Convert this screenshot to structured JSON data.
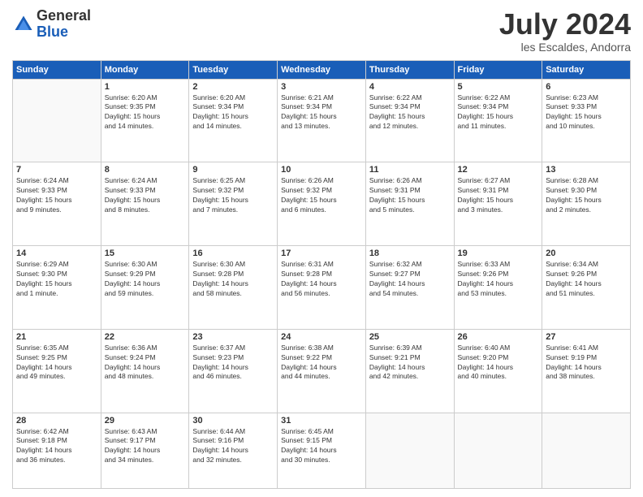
{
  "logo": {
    "general": "General",
    "blue": "Blue"
  },
  "header": {
    "month": "July 2024",
    "location": "les Escaldes, Andorra"
  },
  "weekdays": [
    "Sunday",
    "Monday",
    "Tuesday",
    "Wednesday",
    "Thursday",
    "Friday",
    "Saturday"
  ],
  "weeks": [
    [
      {
        "day": "",
        "info": ""
      },
      {
        "day": "1",
        "info": "Sunrise: 6:20 AM\nSunset: 9:35 PM\nDaylight: 15 hours\nand 14 minutes."
      },
      {
        "day": "2",
        "info": "Sunrise: 6:20 AM\nSunset: 9:34 PM\nDaylight: 15 hours\nand 14 minutes."
      },
      {
        "day": "3",
        "info": "Sunrise: 6:21 AM\nSunset: 9:34 PM\nDaylight: 15 hours\nand 13 minutes."
      },
      {
        "day": "4",
        "info": "Sunrise: 6:22 AM\nSunset: 9:34 PM\nDaylight: 15 hours\nand 12 minutes."
      },
      {
        "day": "5",
        "info": "Sunrise: 6:22 AM\nSunset: 9:34 PM\nDaylight: 15 hours\nand 11 minutes."
      },
      {
        "day": "6",
        "info": "Sunrise: 6:23 AM\nSunset: 9:33 PM\nDaylight: 15 hours\nand 10 minutes."
      }
    ],
    [
      {
        "day": "7",
        "info": "Sunrise: 6:24 AM\nSunset: 9:33 PM\nDaylight: 15 hours\nand 9 minutes."
      },
      {
        "day": "8",
        "info": "Sunrise: 6:24 AM\nSunset: 9:33 PM\nDaylight: 15 hours\nand 8 minutes."
      },
      {
        "day": "9",
        "info": "Sunrise: 6:25 AM\nSunset: 9:32 PM\nDaylight: 15 hours\nand 7 minutes."
      },
      {
        "day": "10",
        "info": "Sunrise: 6:26 AM\nSunset: 9:32 PM\nDaylight: 15 hours\nand 6 minutes."
      },
      {
        "day": "11",
        "info": "Sunrise: 6:26 AM\nSunset: 9:31 PM\nDaylight: 15 hours\nand 5 minutes."
      },
      {
        "day": "12",
        "info": "Sunrise: 6:27 AM\nSunset: 9:31 PM\nDaylight: 15 hours\nand 3 minutes."
      },
      {
        "day": "13",
        "info": "Sunrise: 6:28 AM\nSunset: 9:30 PM\nDaylight: 15 hours\nand 2 minutes."
      }
    ],
    [
      {
        "day": "14",
        "info": "Sunrise: 6:29 AM\nSunset: 9:30 PM\nDaylight: 15 hours\nand 1 minute."
      },
      {
        "day": "15",
        "info": "Sunrise: 6:30 AM\nSunset: 9:29 PM\nDaylight: 14 hours\nand 59 minutes."
      },
      {
        "day": "16",
        "info": "Sunrise: 6:30 AM\nSunset: 9:28 PM\nDaylight: 14 hours\nand 58 minutes."
      },
      {
        "day": "17",
        "info": "Sunrise: 6:31 AM\nSunset: 9:28 PM\nDaylight: 14 hours\nand 56 minutes."
      },
      {
        "day": "18",
        "info": "Sunrise: 6:32 AM\nSunset: 9:27 PM\nDaylight: 14 hours\nand 54 minutes."
      },
      {
        "day": "19",
        "info": "Sunrise: 6:33 AM\nSunset: 9:26 PM\nDaylight: 14 hours\nand 53 minutes."
      },
      {
        "day": "20",
        "info": "Sunrise: 6:34 AM\nSunset: 9:26 PM\nDaylight: 14 hours\nand 51 minutes."
      }
    ],
    [
      {
        "day": "21",
        "info": "Sunrise: 6:35 AM\nSunset: 9:25 PM\nDaylight: 14 hours\nand 49 minutes."
      },
      {
        "day": "22",
        "info": "Sunrise: 6:36 AM\nSunset: 9:24 PM\nDaylight: 14 hours\nand 48 minutes."
      },
      {
        "day": "23",
        "info": "Sunrise: 6:37 AM\nSunset: 9:23 PM\nDaylight: 14 hours\nand 46 minutes."
      },
      {
        "day": "24",
        "info": "Sunrise: 6:38 AM\nSunset: 9:22 PM\nDaylight: 14 hours\nand 44 minutes."
      },
      {
        "day": "25",
        "info": "Sunrise: 6:39 AM\nSunset: 9:21 PM\nDaylight: 14 hours\nand 42 minutes."
      },
      {
        "day": "26",
        "info": "Sunrise: 6:40 AM\nSunset: 9:20 PM\nDaylight: 14 hours\nand 40 minutes."
      },
      {
        "day": "27",
        "info": "Sunrise: 6:41 AM\nSunset: 9:19 PM\nDaylight: 14 hours\nand 38 minutes."
      }
    ],
    [
      {
        "day": "28",
        "info": "Sunrise: 6:42 AM\nSunset: 9:18 PM\nDaylight: 14 hours\nand 36 minutes."
      },
      {
        "day": "29",
        "info": "Sunrise: 6:43 AM\nSunset: 9:17 PM\nDaylight: 14 hours\nand 34 minutes."
      },
      {
        "day": "30",
        "info": "Sunrise: 6:44 AM\nSunset: 9:16 PM\nDaylight: 14 hours\nand 32 minutes."
      },
      {
        "day": "31",
        "info": "Sunrise: 6:45 AM\nSunset: 9:15 PM\nDaylight: 14 hours\nand 30 minutes."
      },
      {
        "day": "",
        "info": ""
      },
      {
        "day": "",
        "info": ""
      },
      {
        "day": "",
        "info": ""
      }
    ]
  ]
}
